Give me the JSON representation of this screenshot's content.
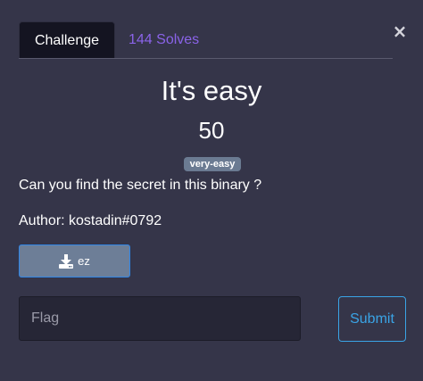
{
  "modal": {
    "close_glyph": "×"
  },
  "tabs": [
    {
      "label": "Challenge",
      "active": true
    },
    {
      "label": "144 Solves",
      "active": false
    }
  ],
  "challenge": {
    "name": "It's easy",
    "points": "50",
    "tag": "very-easy",
    "description": "Can you find the secret in this binary ?",
    "author": "Author: kostadin#0792"
  },
  "file": {
    "label": "ez",
    "icon": "download-icon"
  },
  "flag": {
    "placeholder": "Flag",
    "value": ""
  },
  "submit": {
    "label": "Submit"
  },
  "colors": {
    "background": "#353549",
    "tab_active_bg": "#141421",
    "tab_link": "#8a63e8",
    "badge_bg": "#6b7b92",
    "download_bg": "#6d7e97",
    "download_border": "#2f86e8",
    "submit_accent": "#3aa4e6",
    "input_bg": "#262636"
  }
}
